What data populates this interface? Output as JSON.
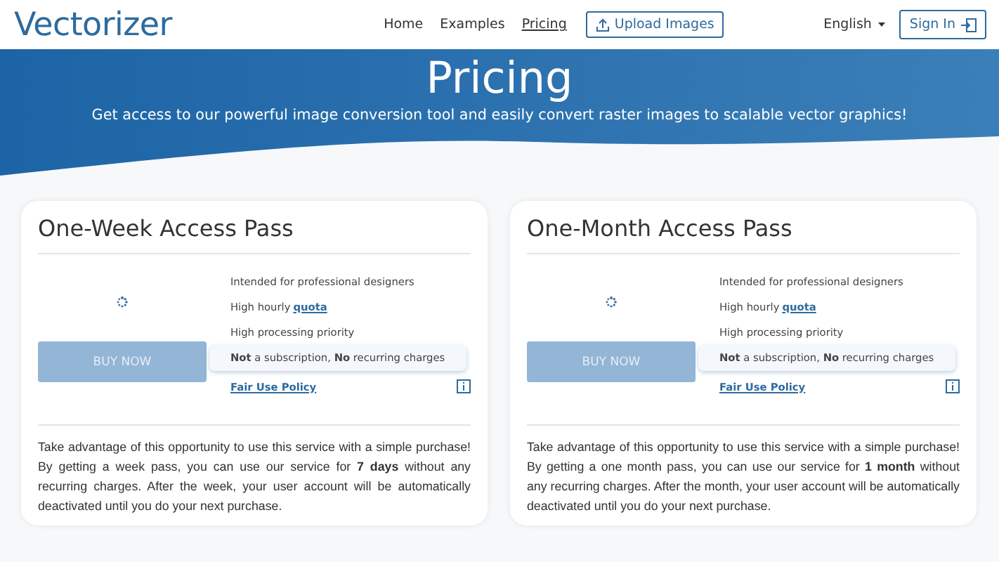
{
  "header": {
    "logo": "Vectorizer",
    "nav": [
      {
        "label": "Home",
        "selected": false
      },
      {
        "label": "Examples",
        "selected": false
      },
      {
        "label": "Pricing",
        "selected": true
      }
    ],
    "upload_button": "Upload Images",
    "language": "English",
    "sign_in": "Sign In"
  },
  "hero": {
    "title": "Pricing",
    "subtitle": "Get access to our powerful image conversion tool and easily convert raster images to scalable vector graphics!"
  },
  "plans": [
    {
      "title": "One-Week Access Pass",
      "buy_button": {
        "label": "BUY NOW",
        "disabled": true
      },
      "features": [
        {
          "kind": "plain",
          "text": "Intended for professional designers"
        },
        {
          "kind": "link",
          "text": "High hourly",
          "link": "quota"
        },
        {
          "kind": "plain",
          "text": "High processing priority"
        },
        {
          "kind": "note",
          "text": "**Not** a subscription, **No** recurring charges"
        }
      ],
      "policy_link": "Fair Use Policy",
      "description": "Take advantage of this opportunity to use this service with a simple purchase! By getting a week pass, you can use our service for **7 days** without any recurring charges. After the week, your user account will be automatically deactivated until you do your next purchase."
    },
    {
      "title": "One-Month Access Pass",
      "buy_button": {
        "label": "BUY NOW",
        "disabled": true
      },
      "features": [
        {
          "kind": "plain",
          "text": "Intended for professional designers"
        },
        {
          "kind": "link",
          "text": "High hourly",
          "link": "quota"
        },
        {
          "kind": "plain",
          "text": "High processing priority"
        },
        {
          "kind": "note",
          "text": "**Not** a subscription, **No** recurring charges"
        }
      ],
      "policy_link": "Fair Use Policy",
      "description": "Take advantage of this opportunity to use this service with a simple purchase! By getting a one month pass, you can use our service for **1 month** without any recurring charges. After the month, your user account will be automatically deactivated until you do your next purchase."
    }
  ]
}
